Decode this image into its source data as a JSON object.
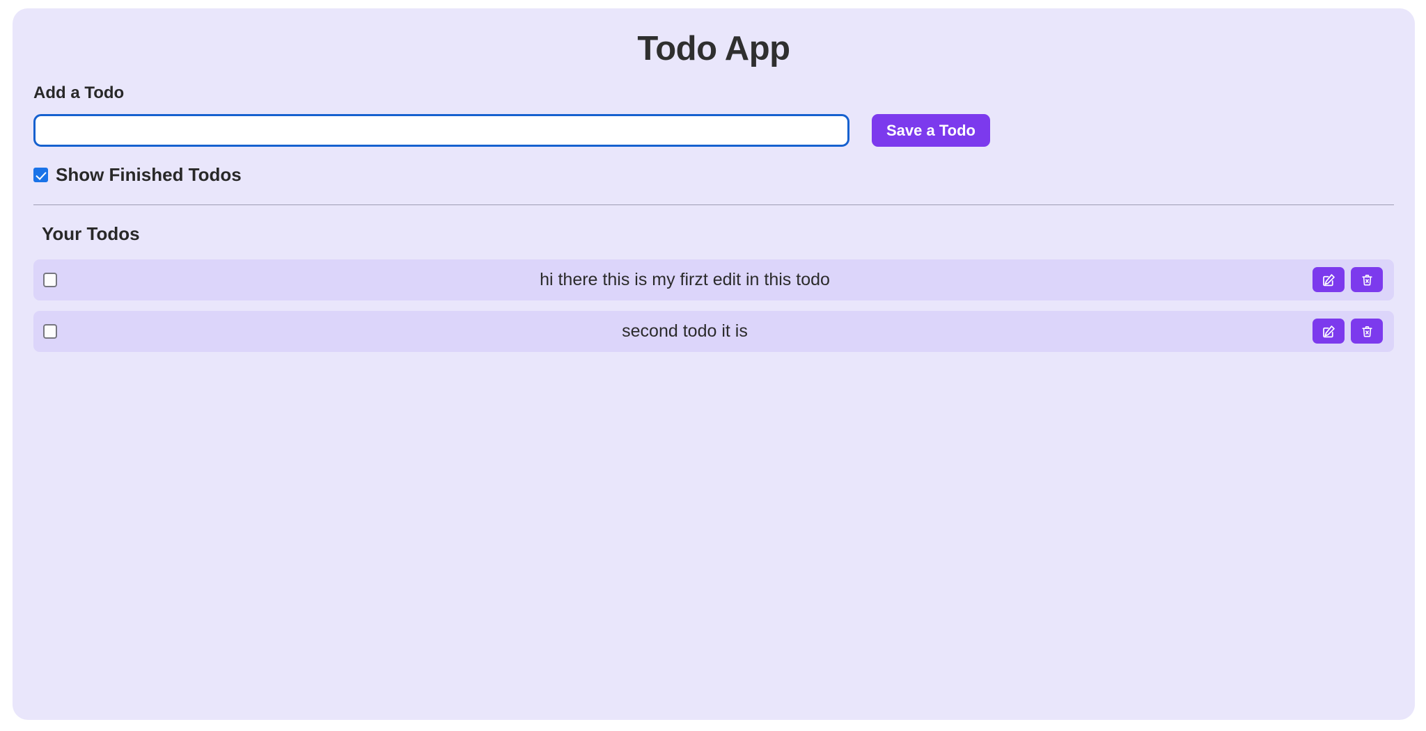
{
  "app": {
    "title": "Todo App",
    "card_bg": "#e9e6fb",
    "accent_purple": "#7c3aed",
    "accent_blue": "#1a73e8",
    "input_border": "#1661cf",
    "row_bg": "#dcd5fa"
  },
  "add_form": {
    "label": "Add a Todo",
    "input_value": "",
    "input_placeholder": "",
    "save_label": "Save a Todo"
  },
  "filter": {
    "label": "Show Finished Todos",
    "checked": true,
    "checkbox_icon": "checkbox-checked-icon"
  },
  "list": {
    "heading": "Your Todos",
    "items": [
      {
        "text": "hi there this is my firzt edit in this todo",
        "done": false,
        "edit_icon": "edit-pencil-square-icon",
        "delete_icon": "trash-x-icon"
      },
      {
        "text": "second todo it is",
        "done": false,
        "edit_icon": "edit-pencil-square-icon",
        "delete_icon": "trash-x-icon"
      }
    ]
  }
}
